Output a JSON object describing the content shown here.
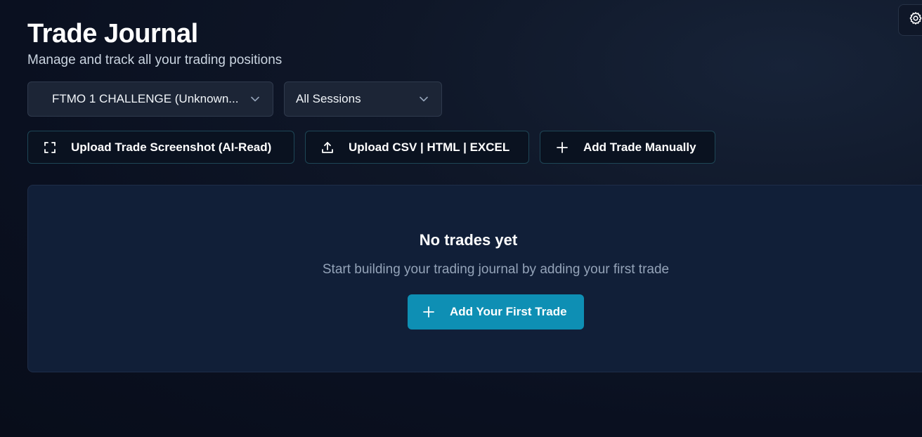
{
  "header": {
    "title": "Trade Journal",
    "subtitle": "Manage and track all your trading positions"
  },
  "filters": {
    "account": {
      "selected": "FTMO 1 CHALLENGE (Unknown...",
      "icon": "chevron-down-icon"
    },
    "session": {
      "selected": "All Sessions",
      "icon": "chevron-down-icon"
    }
  },
  "actions": {
    "screenshot": {
      "label": "Upload Trade Screenshot (AI-Read)",
      "icon": "scan-icon"
    },
    "upload": {
      "label": "Upload CSV | HTML | EXCEL",
      "icon": "upload-icon"
    },
    "add_manual": {
      "label": "Add Trade Manually",
      "icon": "plus-icon"
    }
  },
  "empty_state": {
    "title": "No trades yet",
    "description": "Start building your trading journal by adding your first trade",
    "button_label": "Add Your First Trade",
    "button_icon": "plus-icon"
  },
  "settings": {
    "icon": "gear-icon"
  },
  "colors": {
    "accent": "#0e8fb4",
    "panel": "#111f38",
    "button_border": "#1e4656"
  }
}
